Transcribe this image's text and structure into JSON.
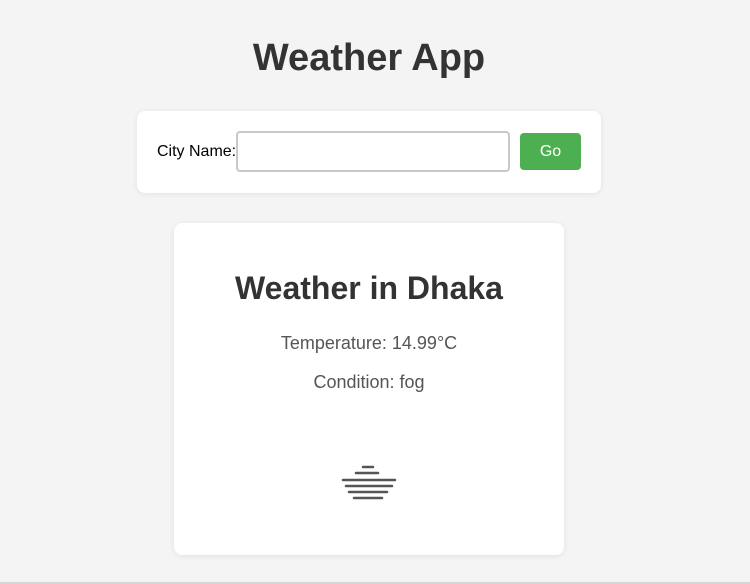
{
  "app": {
    "title": "Weather App"
  },
  "search": {
    "label": "City Name:",
    "value": "",
    "placeholder": "",
    "button_label": "Go"
  },
  "weather": {
    "heading": "Weather in Dhaka",
    "temperature_line": "Temperature: 14.99°C",
    "condition_line": "Condition: fog",
    "icon": "fog-icon"
  },
  "colors": {
    "accent": "#4caf50",
    "page_background": "#f4f4f4",
    "card_background": "#ffffff",
    "text": "#333333"
  }
}
